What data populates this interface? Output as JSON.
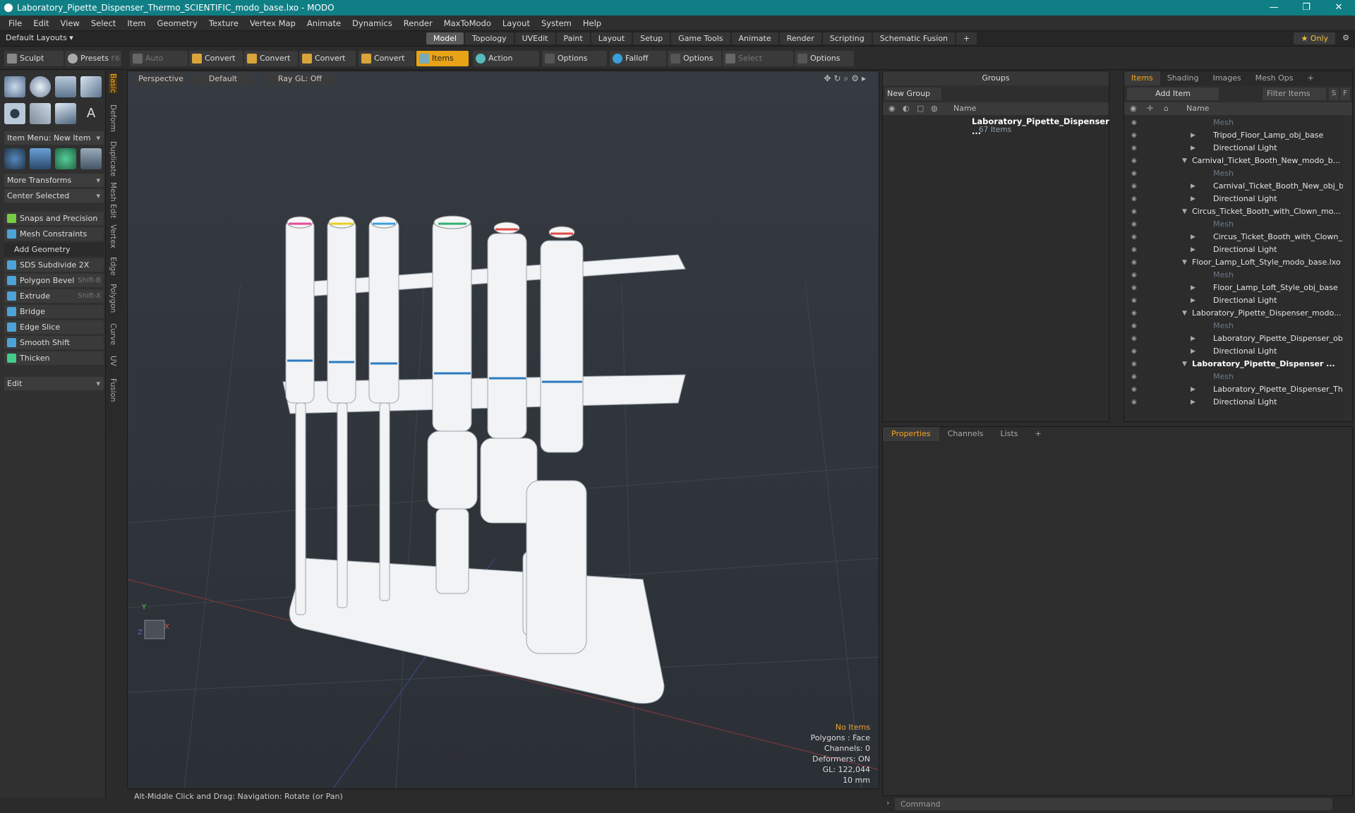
{
  "window": {
    "title": "Laboratory_Pipette_Dispenser_Thermo_SCIENTIFIC_modo_base.lxo - MODO",
    "controls": [
      "—",
      "❐",
      "✕"
    ]
  },
  "menu": [
    "File",
    "Edit",
    "View",
    "Select",
    "Item",
    "Geometry",
    "Texture",
    "Vertex Map",
    "Animate",
    "Dynamics",
    "Render",
    "MaxToModo",
    "Layout",
    "System",
    "Help"
  ],
  "layoutbar": {
    "layouts_label": "Default Layouts ▾",
    "tabs": [
      "Model",
      "Topology",
      "UVEdit",
      "Paint",
      "Layout",
      "Setup",
      "Game Tools",
      "Animate",
      "Render",
      "Scripting",
      "Schematic Fusion",
      "+"
    ],
    "active_tab": "Model",
    "only_label": "★ Only"
  },
  "toolbar": {
    "sculpt": "Sculpt",
    "presets": "Presets",
    "presets_shortcut": "F6",
    "auto_select": "Auto Select",
    "convert1": "Convert",
    "convert2": "Convert",
    "convert3": "Convert",
    "convert4": "Convert",
    "items": "Items",
    "action_center": "Action Center",
    "options1": "Options",
    "falloff": "Falloff",
    "options2": "Options",
    "select_through": "Select Through",
    "options3": "Options"
  },
  "leftpanel": {
    "item_menu": "Item Menu: New Item",
    "more_transforms": "More Transforms",
    "center_selected": "Center Selected",
    "snaps": "Snaps and Precision",
    "mesh_constraints": "Mesh Constraints",
    "add_geometry": "Add Geometry",
    "tools": [
      {
        "label": "SDS Subdivide 2X",
        "shortcut": ""
      },
      {
        "label": "Polygon Bevel",
        "shortcut": "Shift-B"
      },
      {
        "label": "Extrude",
        "shortcut": "Shift-X"
      },
      {
        "label": "Bridge",
        "shortcut": ""
      },
      {
        "label": "Edge Slice",
        "shortcut": ""
      },
      {
        "label": "Smooth Shift",
        "shortcut": ""
      },
      {
        "label": "Thicken",
        "shortcut": ""
      }
    ],
    "edit": "Edit",
    "vtabs": [
      "Basic",
      "Deform",
      "Duplicate",
      "Mesh Edit",
      "Vertex",
      "Edge",
      "Polygon",
      "Curve",
      "UV",
      "Fusion"
    ]
  },
  "viewport": {
    "view": "Perspective",
    "shading": "Default",
    "raygl": "Ray GL: Off",
    "info": {
      "selection": "No Items",
      "polygons": "Polygons : Face",
      "channels": "Channels: 0",
      "deformers": "Deformers: ON",
      "gl": "GL: 122,044",
      "unit": "10 mm"
    },
    "axis_y": "Y",
    "axis_z": "Z",
    "axis_x": "X"
  },
  "statusbar": "Alt-Middle Click and Drag:   Navigation: Rotate (or Pan)",
  "groups": {
    "title": "Groups",
    "new_group": "New Group",
    "name_header": "Name",
    "group_name": "Laboratory_Pipette_Dispenser ...",
    "group_count": "67 Items"
  },
  "items": {
    "tabs": [
      "Items",
      "Shading",
      "Images",
      "Mesh Ops",
      "+"
    ],
    "add_item": "Add Item",
    "filter": "Filter Items",
    "s": "S",
    "f": "F",
    "name_header": "Name",
    "rows": [
      {
        "label": "Mesh",
        "indent": 2,
        "style": "dim"
      },
      {
        "label": "Tripod_Floor_Lamp_obj_base",
        "indent": 2,
        "style": ""
      },
      {
        "label": "Directional Light",
        "indent": 2,
        "style": ""
      },
      {
        "label": "Carnival_Ticket_Booth_New_modo_b...",
        "indent": 1,
        "style": ""
      },
      {
        "label": "Mesh",
        "indent": 2,
        "style": "dim"
      },
      {
        "label": "Carnival_Ticket_Booth_New_obj_b...",
        "indent": 2,
        "style": ""
      },
      {
        "label": "Directional Light",
        "indent": 2,
        "style": ""
      },
      {
        "label": "Circus_Ticket_Booth_with_Clown_mo...",
        "indent": 1,
        "style": ""
      },
      {
        "label": "Mesh",
        "indent": 2,
        "style": "dim"
      },
      {
        "label": "Circus_Ticket_Booth_with_Clown_...",
        "indent": 2,
        "style": ""
      },
      {
        "label": "Directional Light",
        "indent": 2,
        "style": ""
      },
      {
        "label": "Floor_Lamp_Loft_Style_modo_base.lxo",
        "indent": 1,
        "style": ""
      },
      {
        "label": "Mesh",
        "indent": 2,
        "style": "dim"
      },
      {
        "label": "Floor_Lamp_Loft_Style_obj_base",
        "indent": 2,
        "style": ""
      },
      {
        "label": "Directional Light",
        "indent": 2,
        "style": ""
      },
      {
        "label": "Laboratory_Pipette_Dispenser_modo...",
        "indent": 1,
        "style": ""
      },
      {
        "label": "Mesh",
        "indent": 2,
        "style": "dim"
      },
      {
        "label": "Laboratory_Pipette_Dispenser_obj...",
        "indent": 2,
        "style": ""
      },
      {
        "label": "Directional Light",
        "indent": 2,
        "style": ""
      },
      {
        "label": "Laboratory_Pipette_Dispenser ...",
        "indent": 1,
        "style": "bold"
      },
      {
        "label": "Mesh",
        "indent": 2,
        "style": "dim"
      },
      {
        "label": "Laboratory_Pipette_Dispenser_Th ...",
        "indent": 2,
        "style": ""
      },
      {
        "label": "Directional Light",
        "indent": 2,
        "style": ""
      }
    ]
  },
  "props": {
    "tabs": [
      "Properties",
      "Channels",
      "Lists",
      "+"
    ]
  },
  "command": {
    "placeholder": "Command"
  }
}
